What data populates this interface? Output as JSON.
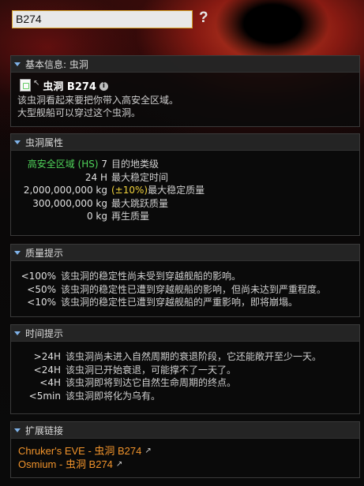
{
  "search": {
    "value": "B274",
    "help": "?"
  },
  "info": {
    "header": "基本信息: 虫洞",
    "ext_arrow": "↖",
    "name": "虫洞 B274",
    "info_icon": "i",
    "lines": [
      "该虫洞看起来要把你带入高安全区域。",
      "大型舰船可以穿过这个虫洞。"
    ]
  },
  "attributes": {
    "header": "虫洞属性",
    "rows": [
      {
        "key": "高安全区域 (HS) 7",
        "value": "目的地类级"
      },
      {
        "key": "24 H",
        "value": "最大稳定时间"
      },
      {
        "key": "2,000,000,000 kg",
        "tolerance": "(±10%)",
        "value": "最大稳定质量"
      },
      {
        "key": "300,000,000 kg",
        "value": "最大跳跃质量"
      },
      {
        "key": "0 kg",
        "value": "再生质量"
      }
    ],
    "destination_green": "高安全区域 (HS)",
    "destination_class": "7"
  },
  "mass_tips": {
    "header": "质量提示",
    "rows": [
      {
        "key": "<100%",
        "value": "该虫洞的稳定性尚未受到穿越舰船的影响。"
      },
      {
        "key": "<50%",
        "value": "该虫洞的稳定性已遭到穿越舰船的影响，但尚未达到严重程度。"
      },
      {
        "key": "<10%",
        "value": "该虫洞的稳定性已遭到穿越舰船的严重影响，即将崩塌。"
      }
    ]
  },
  "time_tips": {
    "header": "时间提示",
    "rows": [
      {
        "key": ">24H",
        "value": "该虫洞尚未进入自然周期的衰退阶段，它还能敞开至少一天。"
      },
      {
        "key": "<24H",
        "value": "该虫洞已开始衰退，可能撑不了一天了。"
      },
      {
        "key": "<4H",
        "value": "该虫洞即将到达它自然生命周期的终点。"
      },
      {
        "key": "<5min",
        "value": "该虫洞即将化为乌有。"
      }
    ]
  },
  "links": {
    "header": "扩展链接",
    "items": [
      {
        "label": "Chruker's EVE - 虫洞 B274",
        "arrow": "↗"
      },
      {
        "label": "Osmium - 虫洞 B274",
        "arrow": "↗"
      }
    ]
  },
  "colors": {
    "accent": "#7fb2e8",
    "high_sec": "#4fd45a",
    "tolerance": "#f0d23c",
    "link": "#f0932b",
    "search_border": "#d9a528"
  }
}
